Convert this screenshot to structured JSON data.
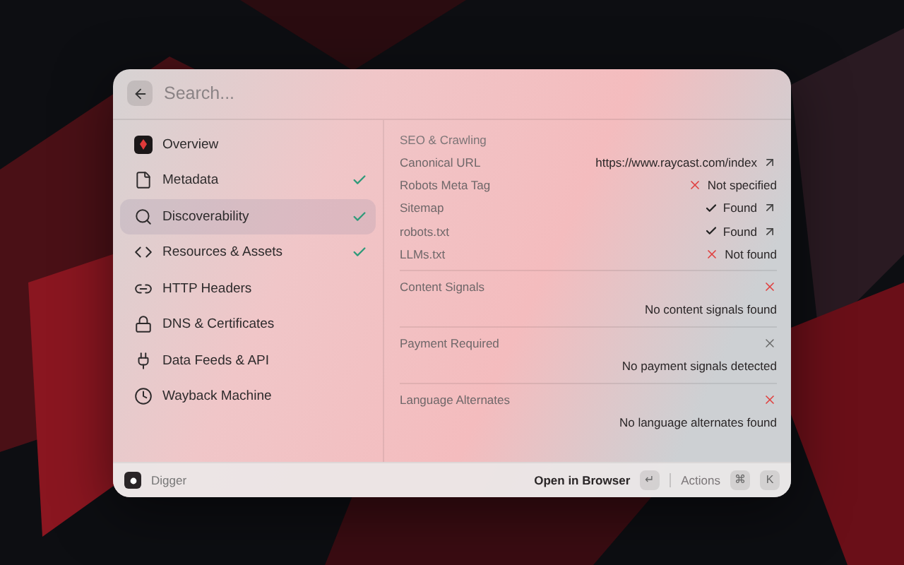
{
  "search": {
    "placeholder": "Search..."
  },
  "sidebar": {
    "items": [
      {
        "label": "Overview",
        "kind": "app",
        "checked": false,
        "selected": false
      },
      {
        "label": "Metadata",
        "kind": "file",
        "checked": true,
        "selected": false
      },
      {
        "label": "Discoverability",
        "kind": "search",
        "checked": true,
        "selected": true
      },
      {
        "label": "Resources & Assets",
        "kind": "code",
        "checked": true,
        "selected": false
      },
      {
        "label": "HTTP Headers",
        "kind": "link",
        "checked": false,
        "selected": false
      },
      {
        "label": "DNS & Certificates",
        "kind": "lock",
        "checked": false,
        "selected": false
      },
      {
        "label": "Data Feeds & API",
        "kind": "plug",
        "checked": false,
        "selected": false
      },
      {
        "label": "Wayback Machine",
        "kind": "clock",
        "checked": false,
        "selected": false
      }
    ]
  },
  "detail": {
    "heading": "SEO & Crawling",
    "rows": [
      {
        "label": "Canonical URL",
        "value": "https://www.raycast.com/index",
        "kind": "plain",
        "external": true
      },
      {
        "label": "Robots Meta Tag",
        "value": "Not specified",
        "kind": "fail",
        "external": false
      },
      {
        "label": "Sitemap",
        "value": "Found",
        "kind": "ok",
        "external": true
      },
      {
        "label": "robots.txt",
        "value": "Found",
        "kind": "ok",
        "external": true
      },
      {
        "label": "LLMs.txt",
        "value": "Not found",
        "kind": "fail",
        "external": false
      }
    ],
    "sections": [
      {
        "title": "Content Signals",
        "kind": "fail",
        "message": "No content signals found"
      },
      {
        "title": "Payment Required",
        "kind": "neutral",
        "message": "No payment signals detected"
      },
      {
        "title": "Language Alternates",
        "kind": "fail",
        "message": "No language alternates found"
      }
    ]
  },
  "footer": {
    "app": "Digger",
    "primary_action": "Open in Browser",
    "primary_key": "↵",
    "actions_label": "Actions",
    "action_keys": [
      "⌘",
      "K"
    ]
  }
}
